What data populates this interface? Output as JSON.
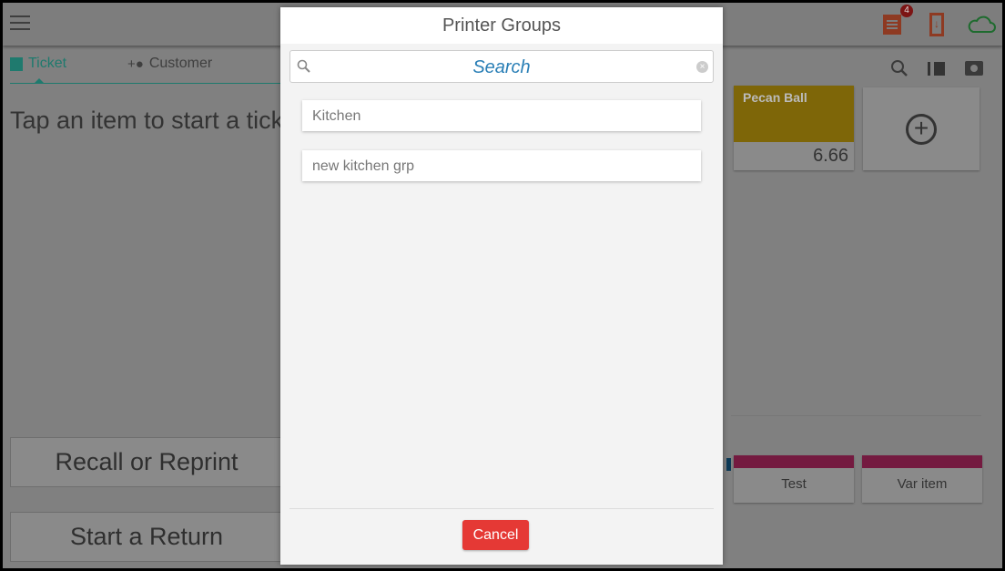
{
  "topbar": {
    "ticket_badge_count": "4"
  },
  "tabs": [
    {
      "label": "Ticket",
      "active": true
    },
    {
      "label": "Customer",
      "active": false
    }
  ],
  "ticket": {
    "hint": "Tap an item to start a ticket",
    "recall_label": "Recall or Reprint",
    "return_label": "Start a Return"
  },
  "items": [
    {
      "name": "Pecan Ball",
      "price": "6.66",
      "color": "#7e6608"
    },
    {
      "name": "Test",
      "color": "#741a40"
    },
    {
      "name": "Var item",
      "color": "#741a40"
    }
  ],
  "dialog": {
    "title": "Printer Groups",
    "search_placeholder": "Search",
    "groups": [
      "Kitchen",
      "new kitchen grp"
    ],
    "cancel_label": "Cancel"
  },
  "colors": {
    "accent": "#1f7a6e",
    "cancel": "#e53935",
    "search_text": "#2a7fb6"
  }
}
